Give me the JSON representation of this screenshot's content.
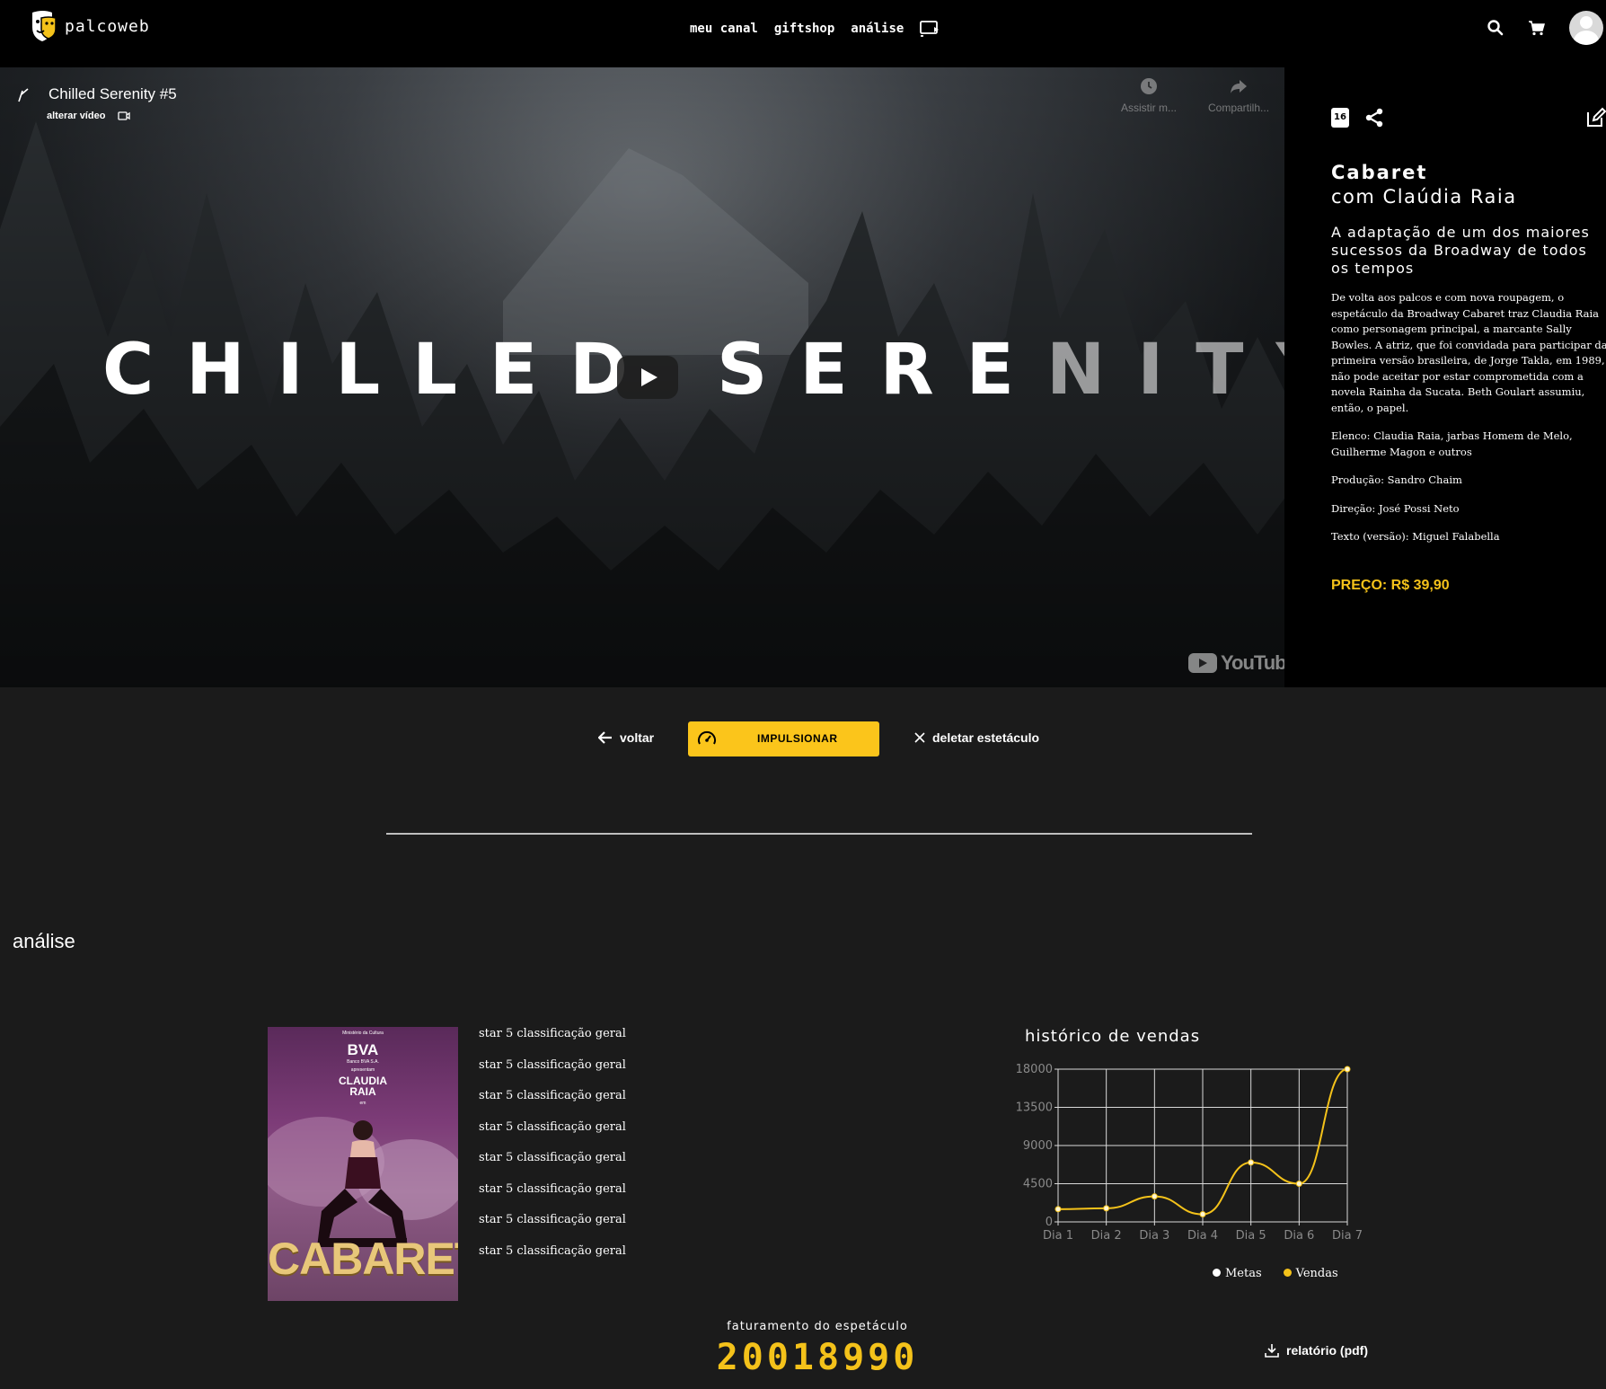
{
  "nav": {
    "brand": "palcoweb",
    "links": [
      "meu canal",
      "giftshop",
      "análise"
    ],
    "icons": [
      "cast-icon",
      "search-icon",
      "cart-icon",
      "avatar"
    ]
  },
  "video": {
    "title": "Chilled Serenity #5",
    "alter_label": "alterar vídeo",
    "watch_later": "Assistir m...",
    "share": "Compartilh...",
    "overlay_text_a": "CHILLED",
    "overlay_text_b": "SERE",
    "overlay_text_c": "NITY",
    "provider": "YouTube"
  },
  "show": {
    "age_rating": "16",
    "title": "Cabaret",
    "subtitle": "com Claúdia Raia",
    "tagline": "A adaptação de um dos maiores sucessos da Broadway de todos os tempos",
    "description": "De volta aos palcos e com nova roupagem, o espetáculo da Broadway Cabaret traz Claudia Raia como personagem principal, a marcante Sally Bowles. A atriz, que foi convidada para participar da primeira versão brasileira, de Jorge Takla, em 1989, não pode aceitar por estar comprometida com a novela Rainha da Sucata. Beth Goulart assumiu, então, o papel.",
    "cast": "Elenco: Claudia Raia, jarbas Homem de Melo, Guilherme Magon e outros",
    "production": "Produção: Sandro Chaim",
    "direction": "Direção: José Possi Neto",
    "text": "Texto (versão): Miguel Falabella",
    "price": "PREÇO: R$ 39,90"
  },
  "actions": {
    "back": "voltar",
    "boost": "IMPULSIONAR",
    "delete": "deletar estetáculo"
  },
  "analysis": {
    "section_title": "análise",
    "poster": {
      "top_small": "Ministério da Cultura",
      "brand": "BVA",
      "brand_sub": "Banco BVA S.A.",
      "presents": "apresentam",
      "star": "CLAUDIA RAIA",
      "em": "em",
      "title": "CABARET"
    },
    "ratings": [
      "star 5 classificação geral",
      "star 5 classificação geral",
      "star 5 classificação geral",
      "star 5 classificação geral",
      "star 5 classificação geral",
      "star 5 classificação geral",
      "star 5 classificação geral",
      "star 5 classificação geral"
    ],
    "revenue_label": "faturamento do espetáculo",
    "revenue_value": "20018990",
    "report_label": "relatório (pdf)"
  },
  "chart_data": {
    "type": "line",
    "title": "histórico de vendas",
    "categories": [
      "Dia 1",
      "Dia 2",
      "Dia 3",
      "Dia 4",
      "Dia 5",
      "Dia 6",
      "Dia 7"
    ],
    "yticks": [
      0,
      4500,
      9000,
      13500,
      18000
    ],
    "ylim": [
      0,
      18000
    ],
    "series": [
      {
        "name": "Metas",
        "color": "#ffffff",
        "values": []
      },
      {
        "name": "Vendas",
        "color": "#f4c21a",
        "values": [
          1500,
          1600,
          3000,
          900,
          7000,
          4500,
          18000
        ]
      }
    ],
    "legend": "bottom-right",
    "grid": true
  }
}
